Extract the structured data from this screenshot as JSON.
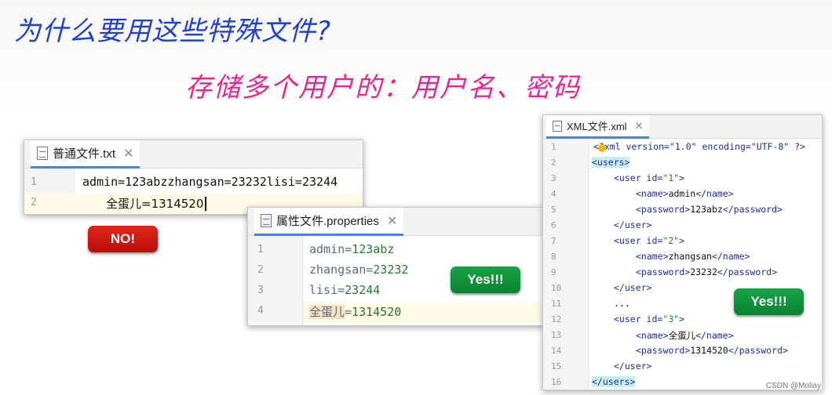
{
  "title": "为什么要用这些特殊文件?",
  "subtitle": "存储多个用户的：用户名、密码",
  "txt_window": {
    "tab_label": "普通文件.txt",
    "close": "✕",
    "lines": [
      {
        "n": "1",
        "text": "admin=123abzzhangsan=23232lisi=23244"
      },
      {
        "n": "2",
        "text": "全蛋儿=1314520"
      }
    ]
  },
  "no_badge": "NO!",
  "prop_window": {
    "tab_label": "属性文件.properties",
    "close": "✕",
    "lines": [
      {
        "n": "1",
        "key": "admin",
        "val": "123abz"
      },
      {
        "n": "2",
        "key": "zhangsan",
        "val": "23232"
      },
      {
        "n": "3",
        "key": "lisi",
        "val": "23244"
      },
      {
        "n": "4",
        "key": "全蛋儿",
        "val": "1314520"
      }
    ]
  },
  "yes_badge_1": "Yes!!!",
  "xml_window": {
    "tab_label": "XML文件.xml",
    "close": "✕",
    "line_numbers": [
      "1",
      "2",
      "3",
      "4",
      "5",
      "6",
      "7",
      "8",
      "9",
      "10",
      "11",
      "12",
      "13",
      "14",
      "15",
      "16"
    ],
    "xml_decl": "<?xml version=\"1.0\" encoding=\"UTF-8\" ?>",
    "lines": [
      "<users>",
      "<user id=\"1\">",
      "<name>admin</name>",
      "<password>123abz</password>",
      "</user>",
      "<user id=\"2\">",
      "<name>zhangsan</name>",
      "<password>23232</password>",
      "</user>",
      "...",
      "<user id=\"3\">",
      "<name>全蛋儿</name>",
      "<password>1314520</password>",
      "</user>",
      "</users>"
    ]
  },
  "yes_badge_2": "Yes!!!",
  "watermark": "CSDN @Moliay"
}
